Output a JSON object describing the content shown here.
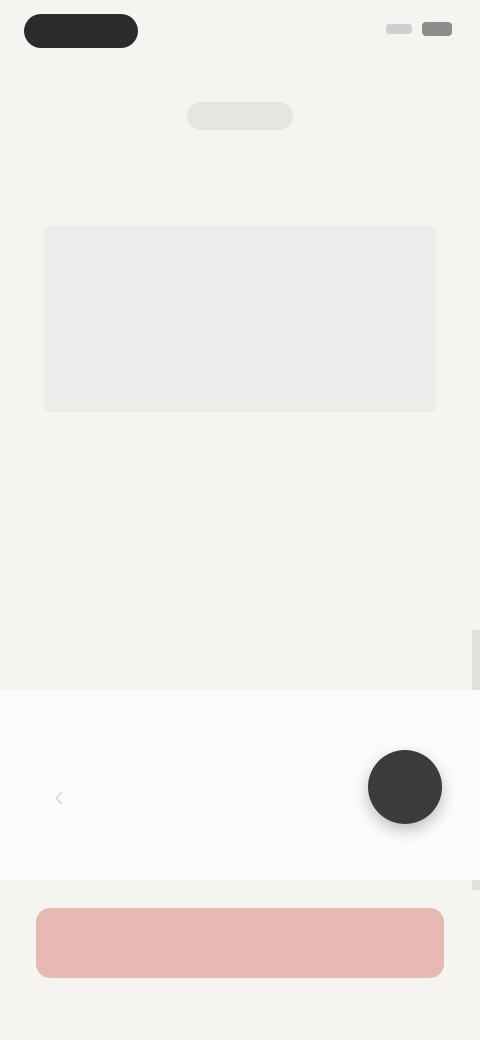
{
  "statusBar": {
    "time": ""
  },
  "stats": [
    {
      "label": ""
    },
    {
      "label": ""
    },
    {
      "label": ""
    },
    {
      "label": ""
    },
    {
      "label": ""
    },
    {
      "label": ""
    }
  ],
  "section": {
    "heading": "",
    "title": "",
    "body": "",
    "seeMore": ""
  },
  "bottom": {
    "stepperLabel": "",
    "stepperSub": ""
  },
  "cta": {
    "label": ""
  }
}
